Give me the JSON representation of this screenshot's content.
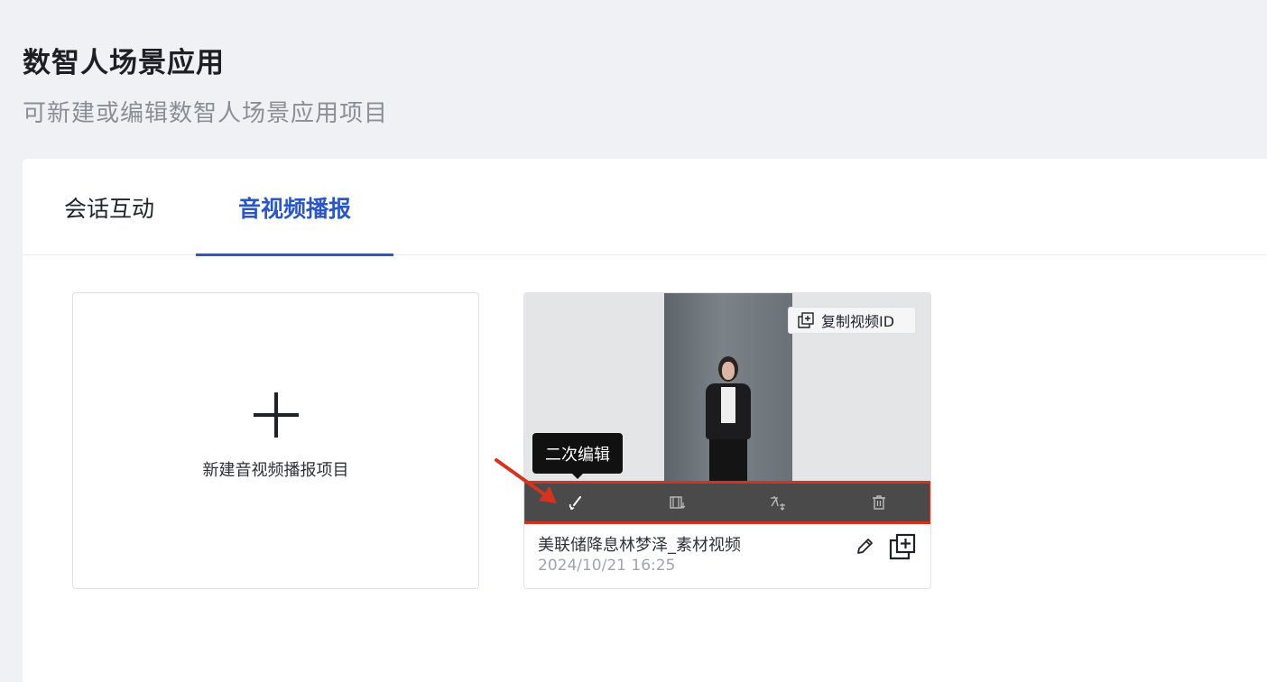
{
  "page": {
    "title": "数智人场景应用",
    "subtitle": "可新建或编辑数智人场景应用项目"
  },
  "tabs": [
    {
      "label": "会话互动",
      "active": false
    },
    {
      "label": "音视频播报",
      "active": true
    }
  ],
  "new_project": {
    "label": "新建音视频播报项目",
    "icon": "plus-icon"
  },
  "video_card": {
    "copy_id_label": "复制视频ID",
    "tooltip": "二次编辑",
    "toolbar_icons": [
      "secondary-edit-icon",
      "film-trim-icon",
      "translate-icon",
      "trash-icon"
    ],
    "title": "美联储降息林梦泽_素材视频",
    "date": "2024/10/21 16:25",
    "highlight_color": "#d5321f"
  },
  "colors": {
    "accent": "#2a56c6",
    "background": "#f0f1f5",
    "annotation_red": "#d5321f"
  }
}
